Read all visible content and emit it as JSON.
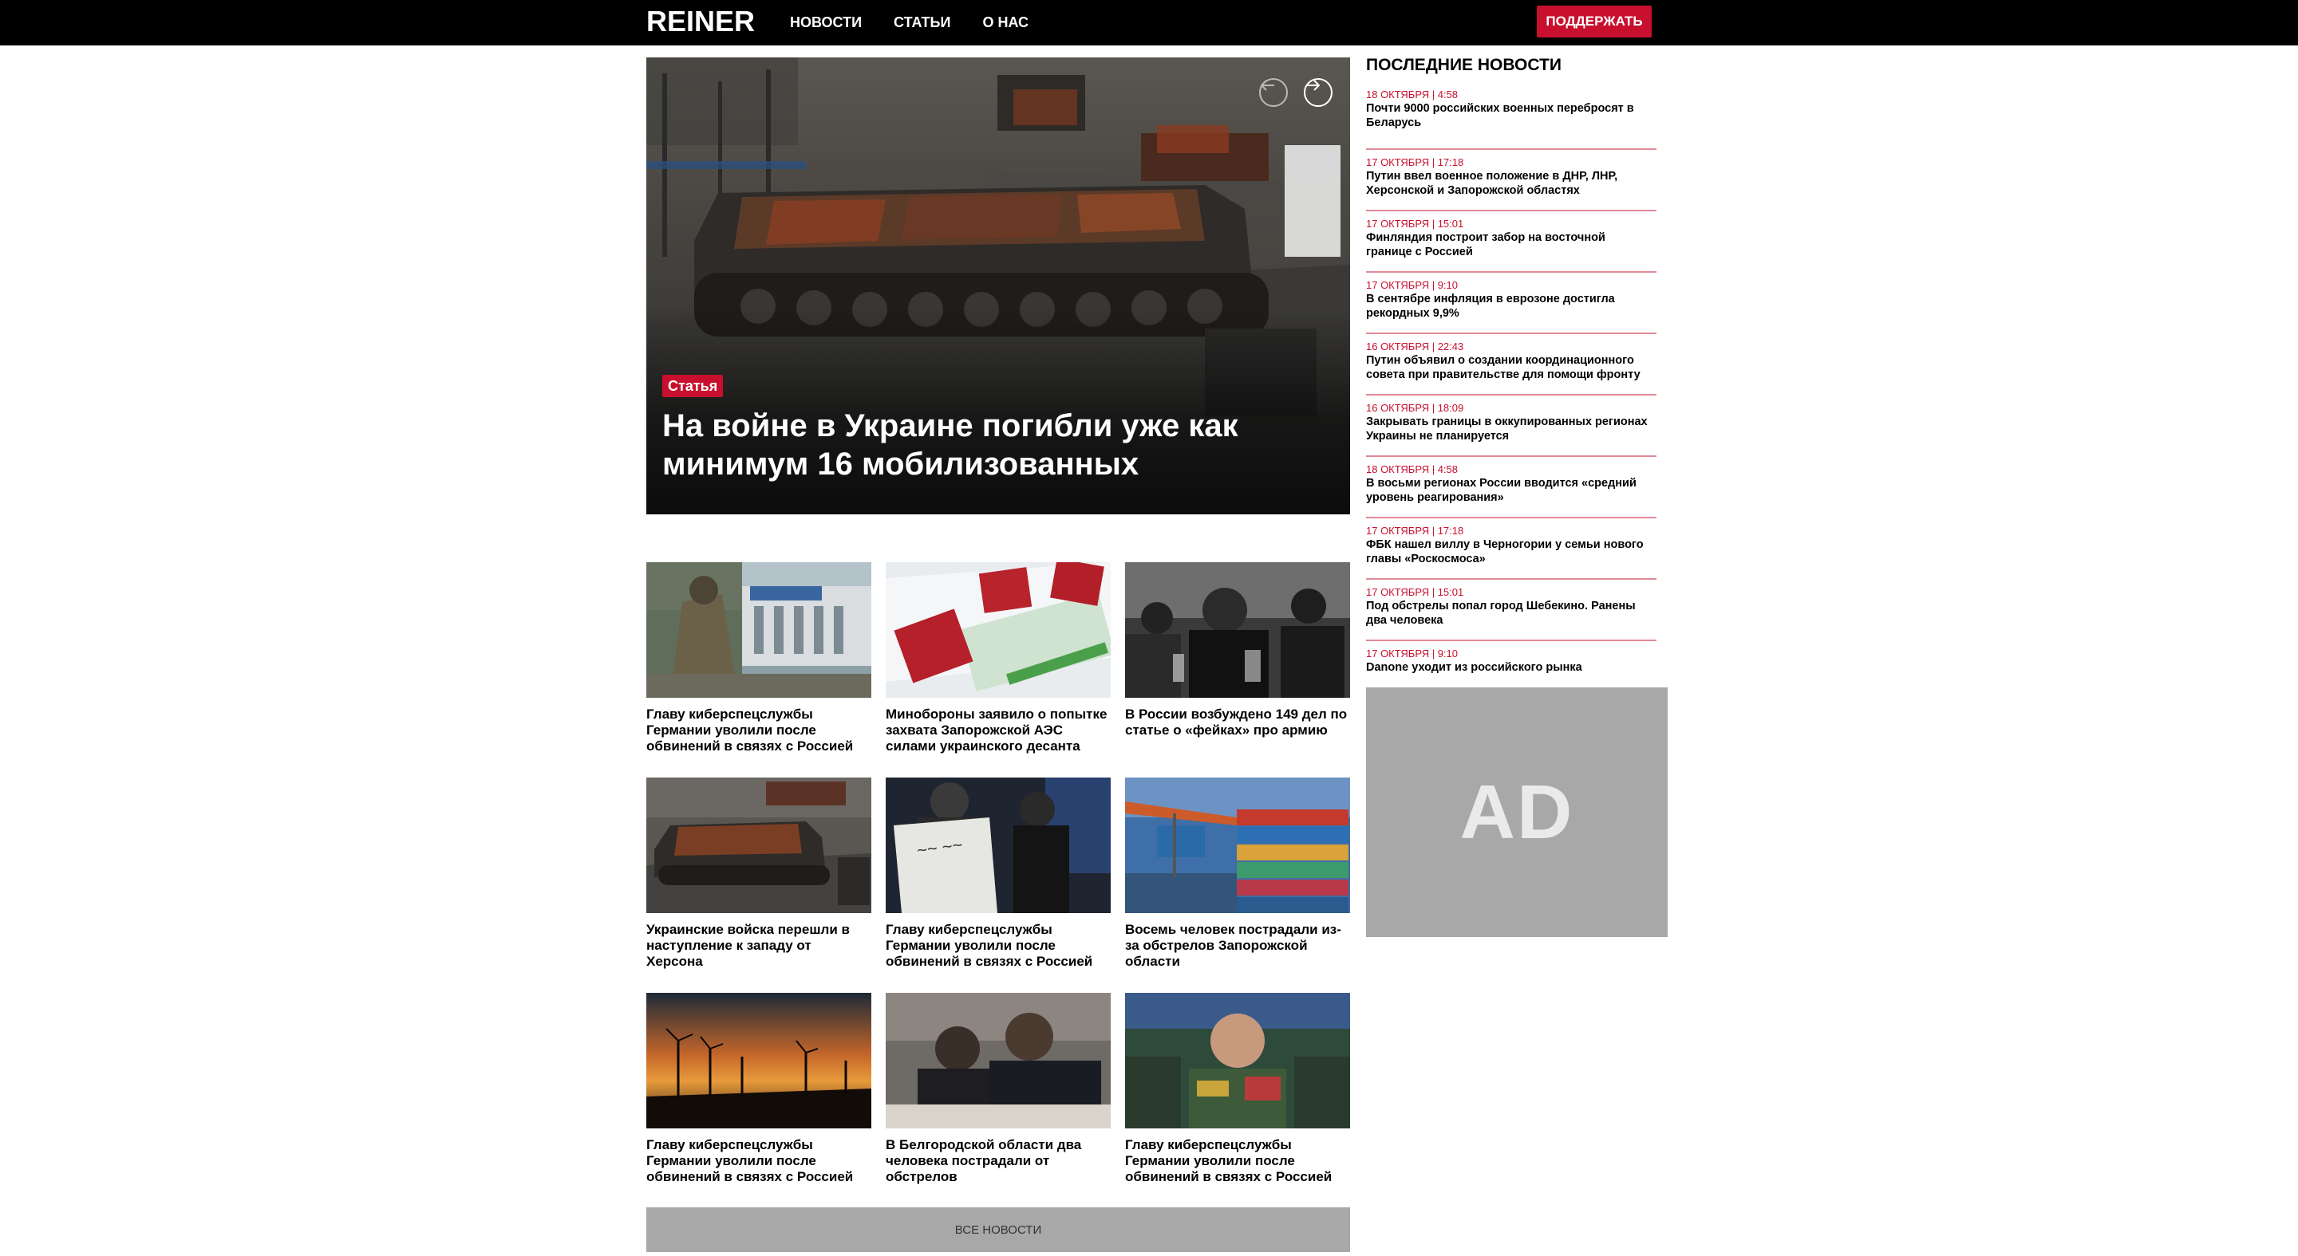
{
  "header": {
    "logo": "REINER",
    "nav": [
      "НОВОСТИ",
      "СТАТЬИ",
      "О НАС"
    ],
    "donate_label": "ПОДДЕРЖАТЬ"
  },
  "hero": {
    "badge": "Статья",
    "title": "На войне в Украине погибли уже как минимум 16 мобилизованных"
  },
  "cards": [
    {
      "title": "Главу киберспецслужбы Германии уволили после обвинений в связях с Россией"
    },
    {
      "title": "Минобороны заявило о попытке захвата Запорожской АЭС силами украинского десанта"
    },
    {
      "title": "В России возбуждено 149 дел по статье о «фейках» про армию"
    },
    {
      "title": "Украинские войска перешли в наступление к западу от Херсона"
    },
    {
      "title": "Главу киберспецслужбы Германии уволили после обвинений в связях с Россией"
    },
    {
      "title": "Восемь человек пострадали из-за обстрелов Запорожской области"
    },
    {
      "title": "Главу киберспецслужбы Германии уволили после обвинений в связях с Россией"
    },
    {
      "title": "В Белгородской области два человека пострадали от обстрелов"
    },
    {
      "title": "Главу киберспецслужбы Германии уволили после обвинений в связях с Россией"
    }
  ],
  "all_news_label": "ВСЕ НОВОСТИ",
  "sidebar": {
    "heading": "ПОСЛЕДНИЕ НОВОСТИ",
    "items": [
      {
        "date": "18 ОКТЯБРЯ | 4:58",
        "title": "Почти 9000 российских военных перебросят в Беларусь"
      },
      {
        "date": "17 ОКТЯБРЯ | 17:18",
        "title": "Путин ввел военное положение в ДНР, ЛНР, Херсонской и Запорожской областях"
      },
      {
        "date": "17 ОКТЯБРЯ | 15:01",
        "title": "Финляндия построит забор на восточной границе с Россией"
      },
      {
        "date": "17 ОКТЯБРЯ | 9:10",
        "title": "В сентябре инфляция в еврозоне достигла рекордных 9,9%"
      },
      {
        "date": "16 ОКТЯБРЯ | 22:43",
        "title": "Путин объявил о создании координационного совета при правительстве для помощи фронту"
      },
      {
        "date": "16 ОКТЯБРЯ | 18:09",
        "title": "Закрывать границы в оккупированных регионах Украины не планируется"
      },
      {
        "date": "18 ОКТЯБРЯ | 4:58",
        "title": "В восьми регионах России вводится «средний уровень реагирования»"
      },
      {
        "date": "17 ОКТЯБРЯ | 17:18",
        "title": "ФБК нашел виллу в Черногории у семьи нового главы «Роскосмоса»"
      },
      {
        "date": "17 ОКТЯБРЯ | 15:01",
        "title": "Под обстрелы попал город Шебекино. Ранены два человека"
      },
      {
        "date": "17 ОКТЯБРЯ | 9:10",
        "title": "Danone уходит из российского рынка"
      }
    ]
  },
  "ad_label": "AD",
  "colors": {
    "accent": "#c8102e",
    "divider": "#e08a96",
    "ad_bg": "#a8a8a8"
  }
}
